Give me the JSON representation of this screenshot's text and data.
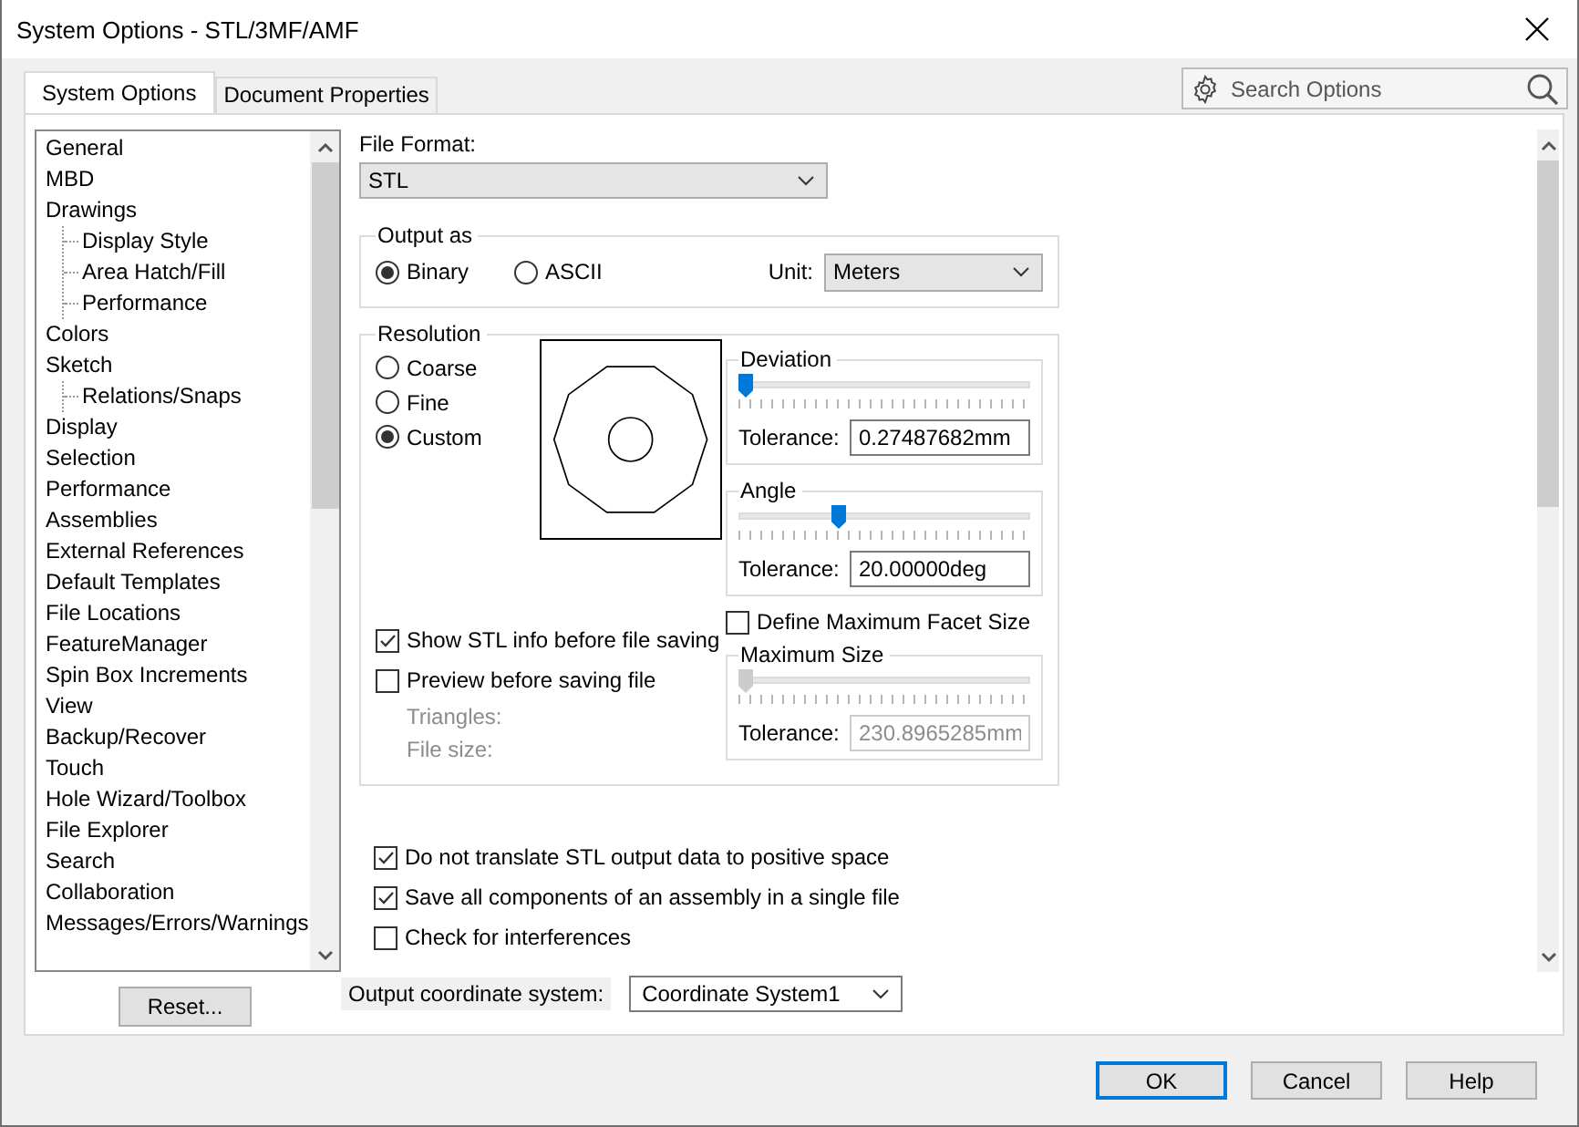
{
  "window": {
    "title": "System Options - STL/3MF/AMF"
  },
  "tabs": [
    {
      "label": "System Options",
      "selected": true
    },
    {
      "label": "Document Properties",
      "selected": false
    }
  ],
  "search": {
    "placeholder": "Search Options"
  },
  "sidebar": {
    "items": [
      {
        "label": "General"
      },
      {
        "label": "MBD"
      },
      {
        "label": "Drawings",
        "children": [
          {
            "label": "Display Style"
          },
          {
            "label": "Area Hatch/Fill"
          },
          {
            "label": "Performance"
          }
        ]
      },
      {
        "label": "Colors"
      },
      {
        "label": "Sketch",
        "children": [
          {
            "label": "Relations/Snaps"
          }
        ]
      },
      {
        "label": "Display"
      },
      {
        "label": "Selection"
      },
      {
        "label": "Performance"
      },
      {
        "label": "Assemblies"
      },
      {
        "label": "External References"
      },
      {
        "label": "Default Templates"
      },
      {
        "label": "File Locations"
      },
      {
        "label": "FeatureManager"
      },
      {
        "label": "Spin Box Increments"
      },
      {
        "label": "View"
      },
      {
        "label": "Backup/Recover"
      },
      {
        "label": "Touch"
      },
      {
        "label": "Hole Wizard/Toolbox"
      },
      {
        "label": "File Explorer"
      },
      {
        "label": "Search"
      },
      {
        "label": "Collaboration"
      },
      {
        "label": "Messages/Errors/Warnings"
      }
    ],
    "reset": "Reset..."
  },
  "file_format": {
    "label": "File Format:",
    "value": "STL"
  },
  "output_as": {
    "title": "Output as",
    "options": [
      {
        "label": "Binary",
        "selected": true
      },
      {
        "label": "ASCII",
        "selected": false
      }
    ],
    "unit_label": "Unit:",
    "unit_value": "Meters"
  },
  "resolution": {
    "title": "Resolution",
    "options": [
      {
        "label": "Coarse",
        "selected": false
      },
      {
        "label": "Fine",
        "selected": false
      },
      {
        "label": "Custom",
        "selected": true
      }
    ],
    "sliders": [
      {
        "title": "Deviation",
        "level": 0.0,
        "tolerance_label": "Tolerance:",
        "tolerance": "0.27487682mm",
        "disabled": false
      },
      {
        "title": "Angle",
        "level": 0.34,
        "tolerance_label": "Tolerance:",
        "tolerance": "20.00000deg",
        "disabled": false
      }
    ],
    "show_info": {
      "label": "Show STL info before file saving",
      "checked": true
    },
    "preview": {
      "label": "Preview before saving file",
      "checked": false
    },
    "triangles_label": "Triangles:",
    "file_size_label": "File size:",
    "define_max": {
      "label": "Define Maximum Facet Size",
      "checked": false
    },
    "max_size": {
      "title": "Maximum Size",
      "level": 0.0,
      "tolerance_label": "Tolerance:",
      "tolerance": "230.8965285mm",
      "disabled": true
    }
  },
  "options": [
    {
      "label": "Do not translate STL output data to positive space",
      "checked": true
    },
    {
      "label": "Save all components of an assembly in a single file",
      "checked": true
    },
    {
      "label": "Check for interferences",
      "checked": false
    }
  ],
  "coordinate": {
    "label": "Output coordinate system:",
    "value": "Coordinate System1"
  },
  "buttons": [
    {
      "label": "OK",
      "default": true
    },
    {
      "label": "Cancel",
      "default": false
    },
    {
      "label": "Help",
      "default": false
    }
  ]
}
